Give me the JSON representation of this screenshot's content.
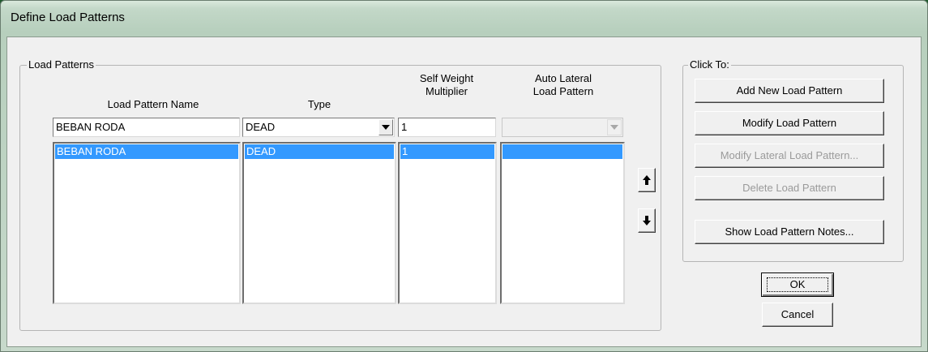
{
  "window": {
    "title": "Define Load Patterns"
  },
  "load_patterns": {
    "group_label": "Load Patterns",
    "headers": {
      "name": "Load Pattern Name",
      "type": "Type",
      "multiplier_line1": "Self Weight",
      "multiplier_line2": "Multiplier",
      "auto_lateral_line1": "Auto Lateral",
      "auto_lateral_line2": "Load Pattern"
    },
    "inputs": {
      "name": "BEBAN RODA",
      "type": "DEAD",
      "multiplier": "1",
      "auto_lateral": ""
    },
    "rows": [
      {
        "name": "BEBAN RODA",
        "type": "DEAD",
        "multiplier": "1",
        "auto_lateral": "",
        "selected": true
      }
    ]
  },
  "click_to": {
    "group_label": "Click To:",
    "buttons": {
      "add": "Add New Load Pattern",
      "modify": "Modify Load Pattern",
      "modify_lateral": "Modify Lateral Load Pattern...",
      "delete": "Delete Load Pattern",
      "notes": "Show Load Pattern Notes..."
    }
  },
  "dialog_buttons": {
    "ok": "OK",
    "cancel": "Cancel"
  },
  "colors": {
    "selection": "#3399ff",
    "face": "#f0f0f0",
    "title_bg": "#c3d8c8"
  }
}
